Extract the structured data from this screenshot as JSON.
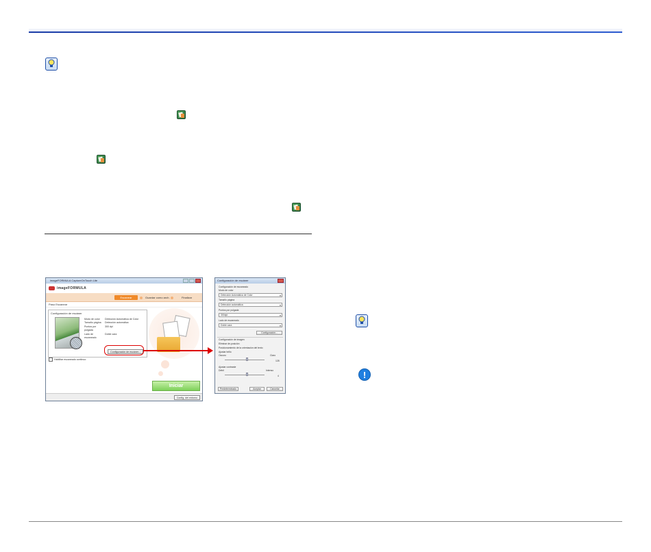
{
  "page": {
    "icons": {
      "hint": "lightbulb-hint-icon",
      "app": "scan-app-icon",
      "caution": "exclamation-caution-icon"
    }
  },
  "main_window": {
    "title": "imageFORMULA CaptureOnTouch Lite",
    "brand": "imageFORMULA",
    "steps": [
      "Escanear",
      "Guardar como arch.",
      "Finalizar"
    ],
    "subheading": "Paso Escanear",
    "panel_title": "Configuración de escáner",
    "settings": [
      {
        "key": "Modo de color",
        "value": "Detección Automática de Color"
      },
      {
        "key": "Tamaño página",
        "value": "Detección automática"
      },
      {
        "key": "Puntos por pulgada",
        "value": "300 dpi"
      },
      {
        "key": "Lado de escaneado",
        "value": "Doble cara"
      }
    ],
    "config_button": "Configuración de escáner...",
    "continuous_checkbox": "Habilitar escaneado continuo",
    "start_button": "Iniciar",
    "footer_button": "Config. del entorno"
  },
  "dialog": {
    "title": "Configuración de escáner",
    "scan_group": "Configuración de escaneado",
    "color_mode_label": "Modo de color",
    "color_mode_value": "Detección Automática de Color",
    "page_size_label": "Tamaño página",
    "page_size_value": "Detección automática",
    "dpi_label": "Puntos por pulgada",
    "dpi_value": "300dpi",
    "side_label": "Lado de escaneado",
    "side_value": "Doble cara",
    "config_button": "Configuración...",
    "image_group": "Configuración de imagen",
    "deskew_label": "Eliminar de-posición",
    "reposition_label": "Posicionamiento de la orientación del texto",
    "brightness_label": "Ajustar brillo",
    "dark_label": "Oscuro",
    "light_label": "Claro",
    "brightness_value": "128",
    "contrast_label": "Ajustar contraste",
    "low_label": "Débil",
    "high_label": "Intenso",
    "contrast_value": "4",
    "default_button": "Predeterminado",
    "accept_button": "Aceptar",
    "cancel_button": "Cancelar"
  },
  "colors": {
    "header_rule": "#1e3fa8",
    "callout": "#dd0000",
    "start_button": "#7ed15a",
    "step_active": "#f08a2a"
  }
}
